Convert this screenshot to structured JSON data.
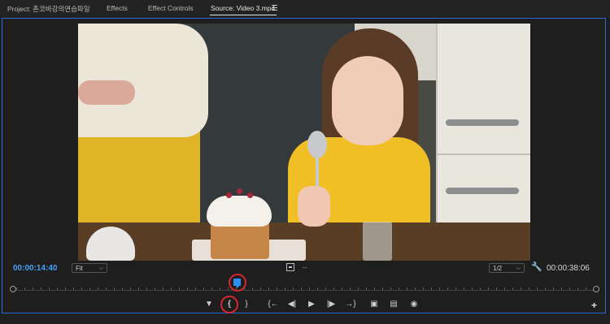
{
  "tabs": [
    {
      "label": "Project: 촌코바강의연습파일",
      "active": false
    },
    {
      "label": "Effects",
      "active": false
    },
    {
      "label": "Effect Controls",
      "active": false
    },
    {
      "label": "Source: Video 3.mp4",
      "active": true
    }
  ],
  "monitor": {
    "current_timecode": "00:00:14:40",
    "zoom_select": "Fit",
    "resolution_select": "1/2",
    "duration_timecode": "00:00:38:06",
    "playhead_fraction": 0.39
  },
  "transport_icons": [
    "add-marker-icon",
    "mark-in-icon",
    "mark-out-icon",
    "go-to-in-icon",
    "step-back-icon",
    "play-icon",
    "step-forward-icon",
    "go-to-out-icon",
    "insert-icon",
    "overwrite-icon",
    "export-frame-icon"
  ],
  "colors": {
    "accent_blue": "#2f8ff1",
    "timecode_blue": "#4a9ff5",
    "highlight_red": "#d7262f"
  }
}
